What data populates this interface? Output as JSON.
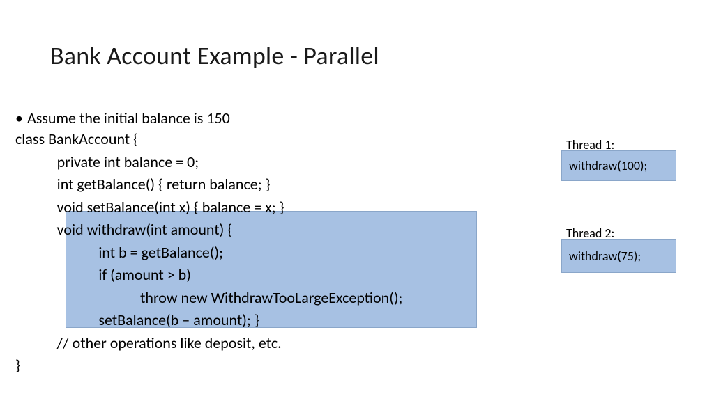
{
  "title": "Bank Account Example - Parallel",
  "bullet": "Assume the initial balance is 150",
  "code": {
    "l1": "class BankAccount {",
    "l2": "            private int balance = 0;",
    "l3": "            int getBalance() { return balance; }",
    "l4": "            void setBalance(int x) { balance = x; }",
    "l5": "            void withdraw(int amount) {",
    "l6": "                        int b = getBalance();",
    "l7": "                        if (amount > b)",
    "l8": "                                    throw new WithdrawTooLargeException();",
    "l9": "                        setBalance(b – amount); }",
    "l10": "            // other operations like deposit, etc.",
    "l11": "}"
  },
  "threads": {
    "t1_label": "Thread 1:",
    "t1_call": "withdraw(100);",
    "t2_label": "Thread 2:",
    "t2_call": "withdraw(75);"
  }
}
